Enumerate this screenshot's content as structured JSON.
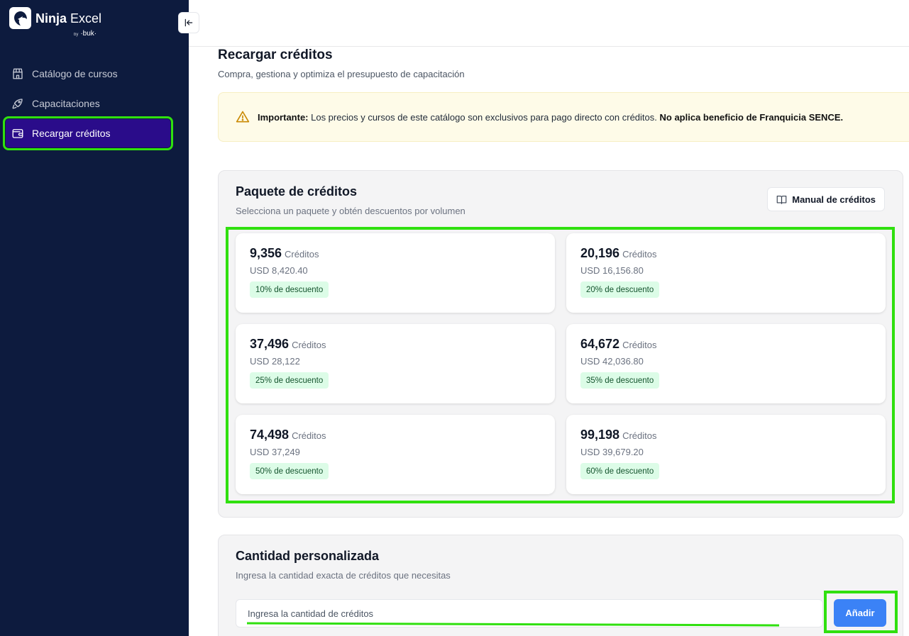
{
  "app": {
    "name_bold": "Ninja",
    "name_rest": "Excel",
    "by": "by",
    "brand": "·buk·"
  },
  "sidebar": {
    "items": [
      {
        "label": "Catálogo de cursos",
        "icon": "store-icon"
      },
      {
        "label": "Capacitaciones",
        "icon": "rocket-icon"
      },
      {
        "label": "Recargar créditos",
        "icon": "wallet-icon",
        "active": true
      }
    ]
  },
  "page": {
    "title": "Recargar créditos",
    "subtitle": "Compra, gestiona y optimiza el presupuesto de capacitación"
  },
  "notice": {
    "lead": "Importante:",
    "text": " Los precios y cursos de este catálogo son exclusivos para pago directo con créditos. ",
    "emphasis": "No aplica beneficio de Franquicia SENCE."
  },
  "packages": {
    "title": "Paquete de créditos",
    "subtitle": "Selecciona un paquete y obtén descuentos por volumen",
    "manual_button": "Manual de créditos",
    "unit": "Créditos",
    "items": [
      {
        "amount": "9,356",
        "price": "USD 8,420.40",
        "discount": "10% de descuento"
      },
      {
        "amount": "20,196",
        "price": "USD 16,156.80",
        "discount": "20% de descuento"
      },
      {
        "amount": "37,496",
        "price": "USD 28,122",
        "discount": "25% de descuento"
      },
      {
        "amount": "64,672",
        "price": "USD 42,036.80",
        "discount": "35% de descuento"
      },
      {
        "amount": "74,498",
        "price": "USD 37,249",
        "discount": "50% de descuento"
      },
      {
        "amount": "99,198",
        "price": "USD 39,679.20",
        "discount": "60% de descuento"
      }
    ]
  },
  "custom": {
    "title": "Cantidad personalizada",
    "subtitle": "Ingresa la cantidad exacta de créditos que necesitas",
    "placeholder": "Ingresa la cantidad de créditos",
    "value": "",
    "add_button": "Añadir"
  },
  "colors": {
    "sidebar_bg": "#0d1b3e",
    "active_item": "#2a0c8a",
    "highlight": "#30e00f",
    "primary_button": "#3b82f6",
    "badge_bg": "#dcfce7",
    "notice_bg": "#fefbe8"
  }
}
